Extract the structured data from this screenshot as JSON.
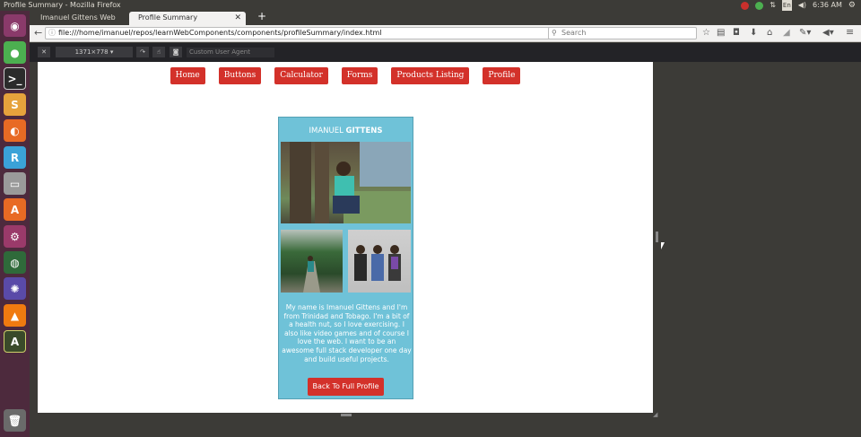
{
  "system": {
    "window_title": "Profile Summary - Mozilla Firefox",
    "keyboard_layout": "En",
    "clock": "6:36 AM"
  },
  "tabs": [
    {
      "label": "Imanuel Gittens Web P…"
    },
    {
      "label": "Profile Summary"
    }
  ],
  "navbar": {
    "url": "file:///home/imanuel/repos/learnWebComponents/components/profileSummary/index.html",
    "search_placeholder": "Search"
  },
  "responsive_toolbar": {
    "dimensions": "1371×778",
    "user_agent_placeholder": "Custom User Agent"
  },
  "page": {
    "nav_links": [
      "Home",
      "Buttons",
      "Calculator",
      "Forms",
      "Products Listing",
      "Profile"
    ],
    "card": {
      "first_name": "IMANUEL",
      "last_name": "GITTENS",
      "bio": "My name is Imanuel Gittens and I'm from Trinidad and Tobago. I'm a bit of a health nut, so I love exercising. I also like video games and of course I love the web. I want to be an awesome full stack developer one day and build useful projects.",
      "button_label": "Back To Full Profile"
    }
  },
  "colors": {
    "nav_button": "#d3312a",
    "card_background": "#6fc2d8",
    "launcher": "#4d2a3d"
  }
}
